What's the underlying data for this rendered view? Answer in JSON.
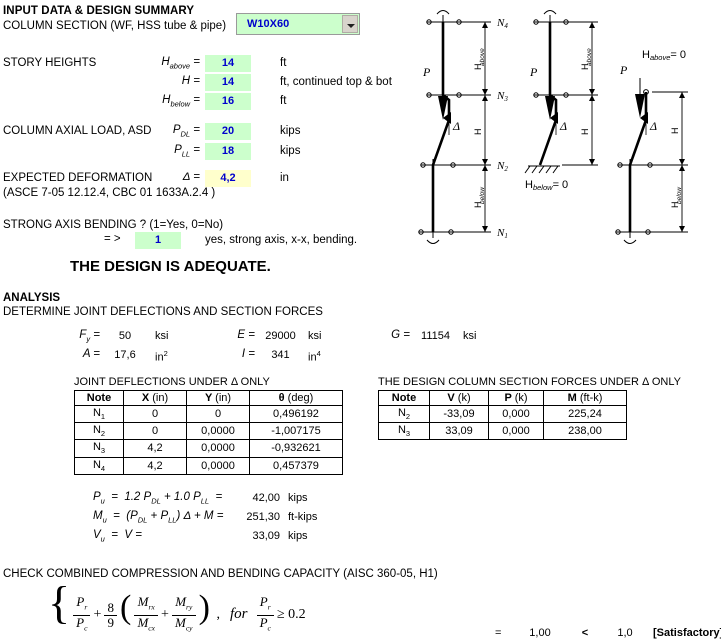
{
  "header": {
    "title": "INPUT DATA & DESIGN SUMMARY",
    "section_label": "COLUMN SECTION (WF, HSS tube & pipe)",
    "section_value": "W10X60"
  },
  "story_heights": {
    "label": "STORY HEIGHTS",
    "rows": [
      {
        "symbol": "H",
        "sub": "above",
        "eq": "=",
        "value": "14",
        "unit": "ft"
      },
      {
        "symbol": "H",
        "sub": "",
        "eq": "=",
        "value": "14",
        "unit": "ft, continued top & bot"
      },
      {
        "symbol": "H",
        "sub": "below",
        "eq": "=",
        "value": "16",
        "unit": "ft"
      }
    ]
  },
  "axial_load": {
    "label": "COLUMN AXIAL LOAD, ASD",
    "rows": [
      {
        "symbol": "P",
        "sub": "DL",
        "eq": "=",
        "value": "20",
        "unit": "kips"
      },
      {
        "symbol": "P",
        "sub": "LL",
        "eq": "=",
        "value": "18",
        "unit": "kips"
      }
    ]
  },
  "deformation": {
    "label": "EXPECTED DEFORMATION",
    "reference": "(ASCE 7-05 12.12.4, CBC 01 1633A.2.4 )",
    "symbol": "Δ",
    "eq": "=",
    "value": "4,2",
    "unit": "in"
  },
  "strong_axis": {
    "question": "STRONG AXIS BENDING ? (1=Yes, 0=No)",
    "arrow": "= >",
    "value": "1",
    "note": "yes, strong axis, x-x, bending."
  },
  "verdict": "THE DESIGN IS ADEQUATE.",
  "analysis": {
    "heading": "ANALYSIS",
    "subheading": "DETERMINE JOINT DEFLECTIONS AND SECTION FORCES",
    "properties": [
      {
        "symbol": "F",
        "sub": "y",
        "eq": "=",
        "value": "50",
        "unit": "ksi",
        "unit_sup": ""
      },
      {
        "symbol": "A",
        "sub": "",
        "eq": "=",
        "value": "17,6",
        "unit": "in",
        "unit_sup": "2"
      },
      {
        "symbol": "E",
        "sub": "",
        "eq": "=",
        "value": "29000",
        "unit": "ksi",
        "unit_sup": ""
      },
      {
        "symbol": "I",
        "sub": "",
        "eq": "=",
        "value": "341",
        "unit": "in",
        "unit_sup": "4"
      },
      {
        "symbol": "G",
        "sub": "",
        "eq": "=",
        "value": "11154",
        "unit": "ksi",
        "unit_sup": ""
      }
    ]
  },
  "deflection_table": {
    "caption": "JOINT DEFLECTIONS UNDER Δ ONLY",
    "columns": [
      "Note",
      "X (in)",
      "Y (in)",
      "θ (deg)"
    ],
    "col_symbols": [
      "Note",
      "X",
      "Y",
      "θ"
    ],
    "col_units": [
      "",
      "(in)",
      "(in)",
      "(deg)"
    ],
    "rows": [
      {
        "note": "N",
        "note_sub": "1",
        "x": "0",
        "y": "0",
        "theta": "0,496192"
      },
      {
        "note": "N",
        "note_sub": "2",
        "x": "0",
        "y": "0,0000",
        "theta": "-1,007175"
      },
      {
        "note": "N",
        "note_sub": "3",
        "x": "4,2",
        "y": "0,0000",
        "theta": "-0,932621"
      },
      {
        "note": "N",
        "note_sub": "4",
        "x": "4,2",
        "y": "0,0000",
        "theta": "0,457379"
      }
    ]
  },
  "forces_table": {
    "caption": "THE DESIGN COLUMN SECTION FORCES UNDER Δ ONLY",
    "col_symbols": [
      "Note",
      "V",
      "P",
      "M"
    ],
    "col_units": [
      "",
      "(k)",
      "(k)",
      "(ft-k)"
    ],
    "rows": [
      {
        "note": "N",
        "note_sub": "2",
        "v": "-33,09",
        "p": "0,000",
        "m": "225,24"
      },
      {
        "note": "N",
        "note_sub": "3",
        "v": "33,09",
        "p": "0,000",
        "m": "238,00"
      }
    ]
  },
  "demands": [
    {
      "symbol": "P",
      "sub": "u",
      "eq1": "=",
      "formula": "1.2 P_DL + 1.0 P_LL",
      "eq2": "=",
      "value": "42,00",
      "unit": "kips"
    },
    {
      "symbol": "M",
      "sub": "u",
      "eq1": "=",
      "formula": "(P_DL + P_LL) Δ + M",
      "eq2": "=",
      "value": "251,30",
      "unit": "ft-kips"
    },
    {
      "symbol": "V",
      "sub": "u",
      "eq1": "=",
      "formula": "V",
      "eq2": "=",
      "value": "33,09",
      "unit": "kips"
    }
  ],
  "capacity_check": {
    "heading": "CHECK COMBINED COMPRESSION AND BENDING CAPACITY (AISC 360-05, H1)",
    "for_text": "for",
    "condition": "≥ 0.2",
    "eq": "=",
    "result": "1,00",
    "comparator": "<",
    "limit": "1,0",
    "status": "[Satisfactory]"
  },
  "diagrams": {
    "node_labels": [
      "N",
      "N",
      "N",
      "N"
    ],
    "node_subs": [
      "1",
      "2",
      "3",
      "4"
    ],
    "dim_above": "H",
    "dim_above_sub": "above",
    "dim_mid": "H",
    "dim_below": "H",
    "dim_below_sub": "below",
    "load_label": "P",
    "delta_label": "Δ",
    "case2_note": "H",
    "case2_note_sub": "below",
    "case2_note_eq": "= 0",
    "case3_note": "H",
    "case3_note_sub": "above",
    "case3_note_eq": "= 0"
  },
  "colors": {
    "input_green": "#ccffcc",
    "input_yellow": "#ffffcc",
    "value_blue": "#0000cc"
  }
}
